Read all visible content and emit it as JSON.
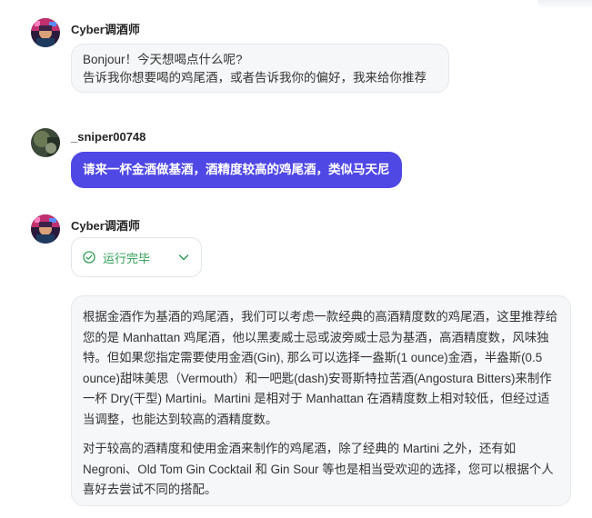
{
  "messages": [
    {
      "role": "assistant",
      "sender": "Cyber调酒师",
      "lines": [
        "Bonjour！今天想喝点什么呢?",
        "告诉我你想要喝的鸡尾酒，或者告诉我你的偏好，我来给你推荐"
      ]
    },
    {
      "role": "user",
      "sender": "_sniper00748",
      "text": "请来一杯金酒做基酒，酒精度较高的鸡尾酒，类似马天尼"
    },
    {
      "role": "assistant",
      "sender": "Cyber调酒师",
      "status": "运行完毕",
      "paragraphs": [
        "根据金酒作为基酒的鸡尾酒，我们可以考虑一款经典的高酒精度数的鸡尾酒，这里推荐给您的是 Manhattan 鸡尾酒，他以黑麦威士忌或波旁威士忌为基酒，高酒精度数，风味独特。但如果您指定需要使用金酒(Gin), 那么可以选择一盎斯(1 ounce)金酒，半盎斯(0.5 ounce)甜味美思（Vermouth）和一吧匙(dash)安哥斯特拉苦酒(Angostura Bitters)来制作一杯 Dry(干型) Martini。Martini 是相对于 Manhattan 在酒精度数上相对较低，但经过适当调整，也能达到较高的酒精度数。",
        "对于较高的酒精度和使用金酒来制作的鸡尾酒，除了经典的 Martini 之外，还有如 Negroni、Old Tom Gin Cocktail 和 Gin Sour 等也是相当受欢迎的选择，您可以根据个人喜好去尝试不同的搭配。"
      ]
    }
  ],
  "icons": {
    "status_icon": "check-circle-icon",
    "expand_icon": "chevron-down-icon"
  },
  "colors": {
    "user_bubble": "#5048e5",
    "status_green": "#2f9e55",
    "bot_bubble": "#f6f7f9"
  }
}
